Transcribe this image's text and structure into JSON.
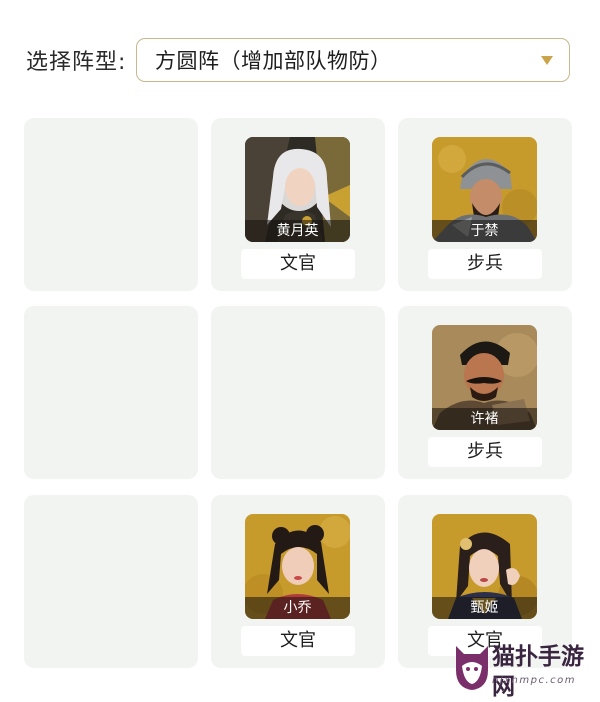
{
  "header": {
    "label": "选择阵型:",
    "selected_formation": "方圆阵（增加部队物防）"
  },
  "grid": {
    "cells": [
      {
        "empty": true
      },
      {
        "empty": false,
        "hero_name": "黄月英",
        "role": "文官",
        "portrait": "huang-yueying-portrait"
      },
      {
        "empty": false,
        "hero_name": "于禁",
        "role": "步兵",
        "portrait": "yu-jin-portrait"
      },
      {
        "empty": true
      },
      {
        "empty": true
      },
      {
        "empty": false,
        "hero_name": "许褚",
        "role": "步兵",
        "portrait": "xu-chu-portrait"
      },
      {
        "empty": true
      },
      {
        "empty": false,
        "hero_name": "小乔",
        "role": "文官",
        "portrait": "xiao-qiao-portrait"
      },
      {
        "empty": false,
        "hero_name": "甄姬",
        "role": "文官",
        "portrait": "zhen-ji-portrait"
      }
    ]
  },
  "watermark": {
    "title": "猫扑手游网",
    "subtitle": "njxhmpc.com"
  },
  "colors": {
    "cell_bg": "#f1f4f1",
    "select_border": "#c8b78f",
    "caret": "#c9a44a",
    "portrait_gold": "#c9a032"
  }
}
